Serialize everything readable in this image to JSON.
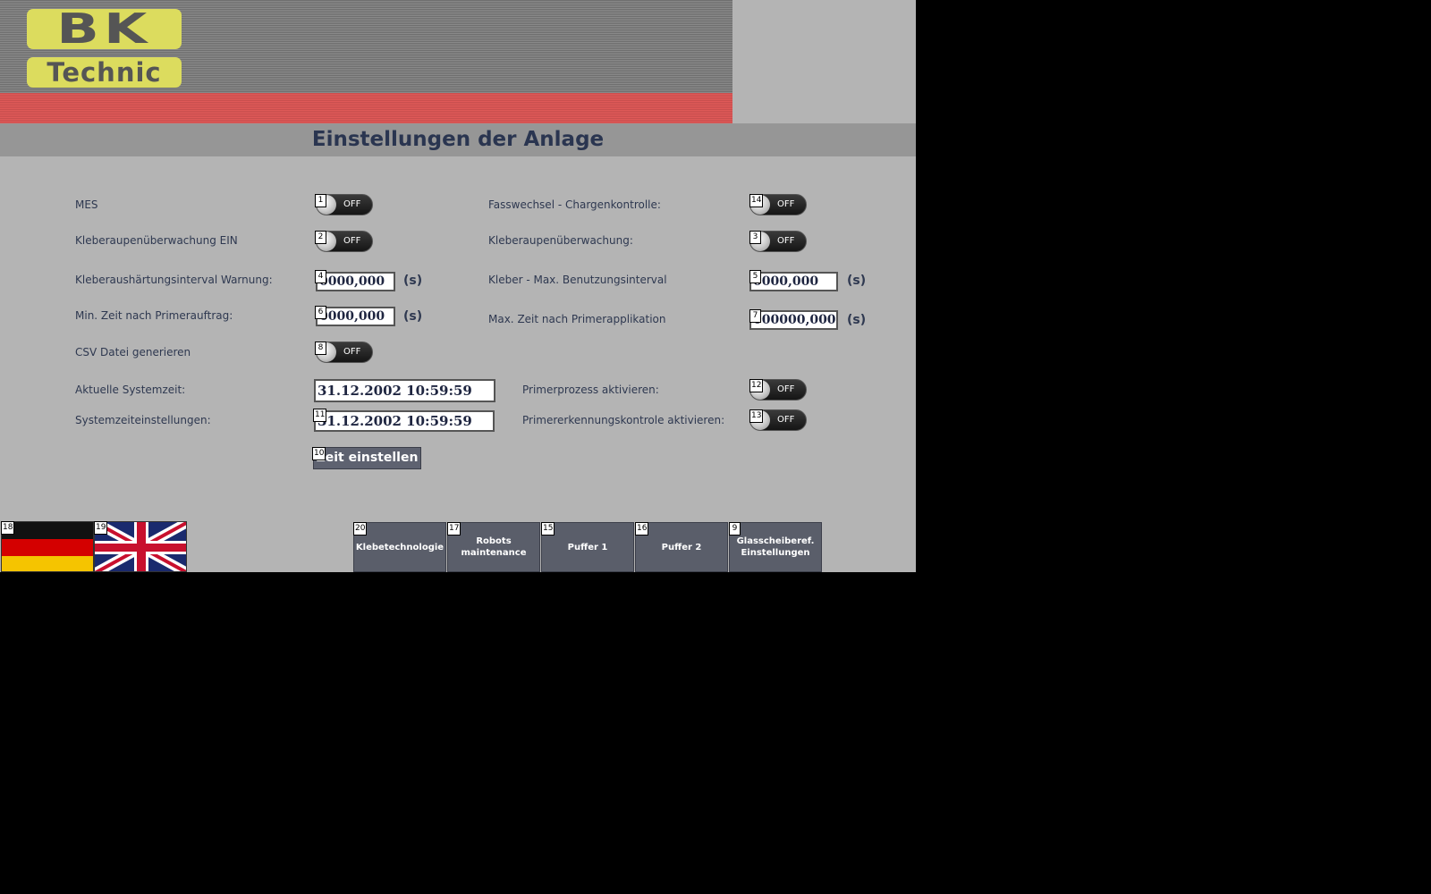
{
  "logo": {
    "top": "BK",
    "bottom": "Technic"
  },
  "title": "Einstellungen der Anlage",
  "toggles": {
    "mes": {
      "label": "MES",
      "badge": "1",
      "state": "OFF"
    },
    "kleberaupen_ein": {
      "label": "Kleberaupenüberwachung EIN",
      "badge": "2",
      "state": "OFF"
    },
    "kleberaupen": {
      "label": "Kleberaupenüberwachung:",
      "badge": "3",
      "state": "OFF"
    },
    "csv": {
      "label": "CSV Datei generieren",
      "badge": "8",
      "state": "OFF"
    },
    "primerprozess": {
      "label": "Primerprozess aktivieren:",
      "badge": "12",
      "state": "OFF"
    },
    "primererkennung": {
      "label": "Primererkennungskontrole aktivieren:",
      "badge": "13",
      "state": "OFF"
    },
    "fasswechsel": {
      "label": "Fasswechsel - Chargenkontrolle:",
      "badge": "14",
      "state": "OFF"
    }
  },
  "fields": {
    "kleberaushaertung": {
      "label": "Kleberaushärtungsinterval Warnung:",
      "badge": "4",
      "value": "0000,000",
      "unit": "(s)"
    },
    "kleber_max": {
      "label": "Kleber - Max. Benutzungsinterval",
      "badge": "5",
      "value": "0000,000",
      "unit": "(s)"
    },
    "min_zeit": {
      "label": "Min. Zeit nach Primerauftrag:",
      "badge": "6",
      "value": "0000,000",
      "unit": "(s)"
    },
    "max_zeit": {
      "label": "Max. Zeit nach Primerapplikation",
      "badge": "7",
      "value": "000000,000",
      "unit": "(s)"
    }
  },
  "systemzeit": {
    "label": "Aktuelle Systemzeit:",
    "value": "31.12.2002 10:59:59"
  },
  "systemzeit_einst": {
    "label": "Systemzeiteinstellungen:",
    "badge": "11",
    "value": "31.12.2002 10:59:59"
  },
  "zeit_button": {
    "label": "Zeit einstellen",
    "badge": "10"
  },
  "flags": {
    "de": {
      "badge": "18"
    },
    "en": {
      "badge": "19"
    }
  },
  "nav": [
    {
      "label": "Klebetechnologie",
      "badge": "20"
    },
    {
      "label": "Robots\nmaintenance",
      "badge": "17"
    },
    {
      "label": "Puffer 1",
      "badge": "15"
    },
    {
      "label": "Puffer 2",
      "badge": "16"
    },
    {
      "label": "Glasscheiberef.\nEinstellungen",
      "badge": "9"
    }
  ],
  "colors": {
    "background": "#b4b4b4",
    "title_bar": "#969696",
    "logo": "#dcdc5e",
    "header_red": "#e05a58",
    "nav_button": "#5a5e6a",
    "text": "#2e3850"
  }
}
